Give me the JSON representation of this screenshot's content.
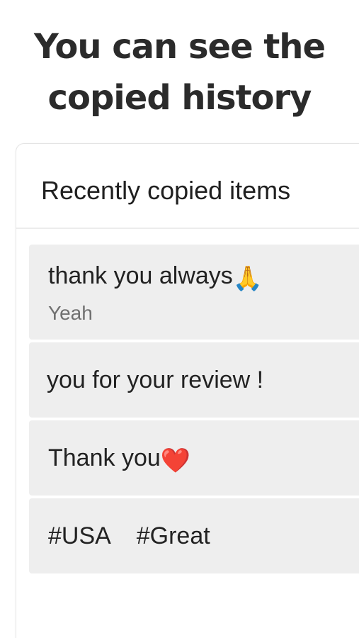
{
  "headline": {
    "line1": "You can see the",
    "line2": "copied history"
  },
  "panel": {
    "title": "Recently copied items",
    "items": [
      {
        "text": "thank you always",
        "emoji": "🙏",
        "sub": "Yeah"
      },
      {
        "text": " you for your review !"
      },
      {
        "text": "Thank you",
        "emoji": "❤️"
      },
      {
        "text": "#USA    #Great"
      }
    ]
  },
  "colors": {
    "headline": "#2b2b2b",
    "item_bg": "#eeeeee",
    "sub_text": "#707070",
    "divider": "#ececec"
  }
}
